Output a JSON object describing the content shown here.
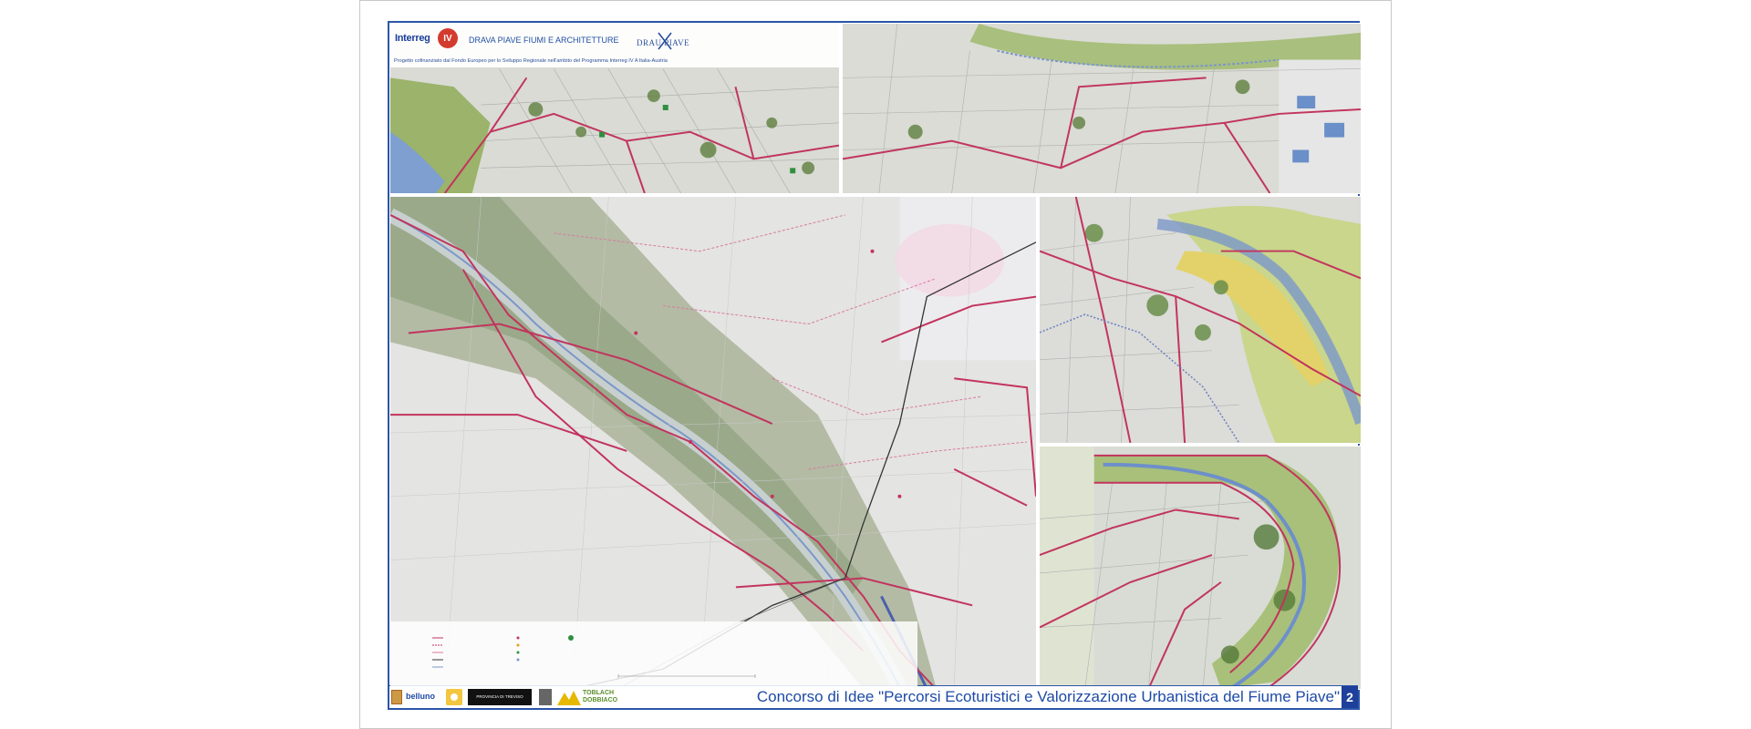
{
  "header": {
    "logo_text": "Interreg",
    "logo_iv": "IV",
    "project_title": "DRAVA PIAVE FIUMI E ARCHITETTURE",
    "drau_logo": "DRAU PIAVE",
    "subtitle": "Progetto cofinanziato dal Fondo Europeo per lo Sviluppo Regionale nell'ambito del Programma Interreg IV A Italia-Austria"
  },
  "footer": {
    "partner_belluno": "belluno",
    "partner_treviso": "PROVINCIA DI TREVISO",
    "partner_toblach": "TOBLACH",
    "partner_dobbiaco": "DOBBIACO",
    "title": "Concorso di Idee \"Percorsi Ecoturistici e Valorizzazione Urbanistica del Fiume Piave\"",
    "page_number": "2"
  },
  "colors": {
    "frame": "#2b55a8",
    "route": "#c2345e",
    "route_light": "#d77aa0",
    "river": "#7c97c9",
    "vegetation": "#6f8f4f",
    "fields": "#dfe1d9",
    "title_blue": "#1e4aa6"
  }
}
